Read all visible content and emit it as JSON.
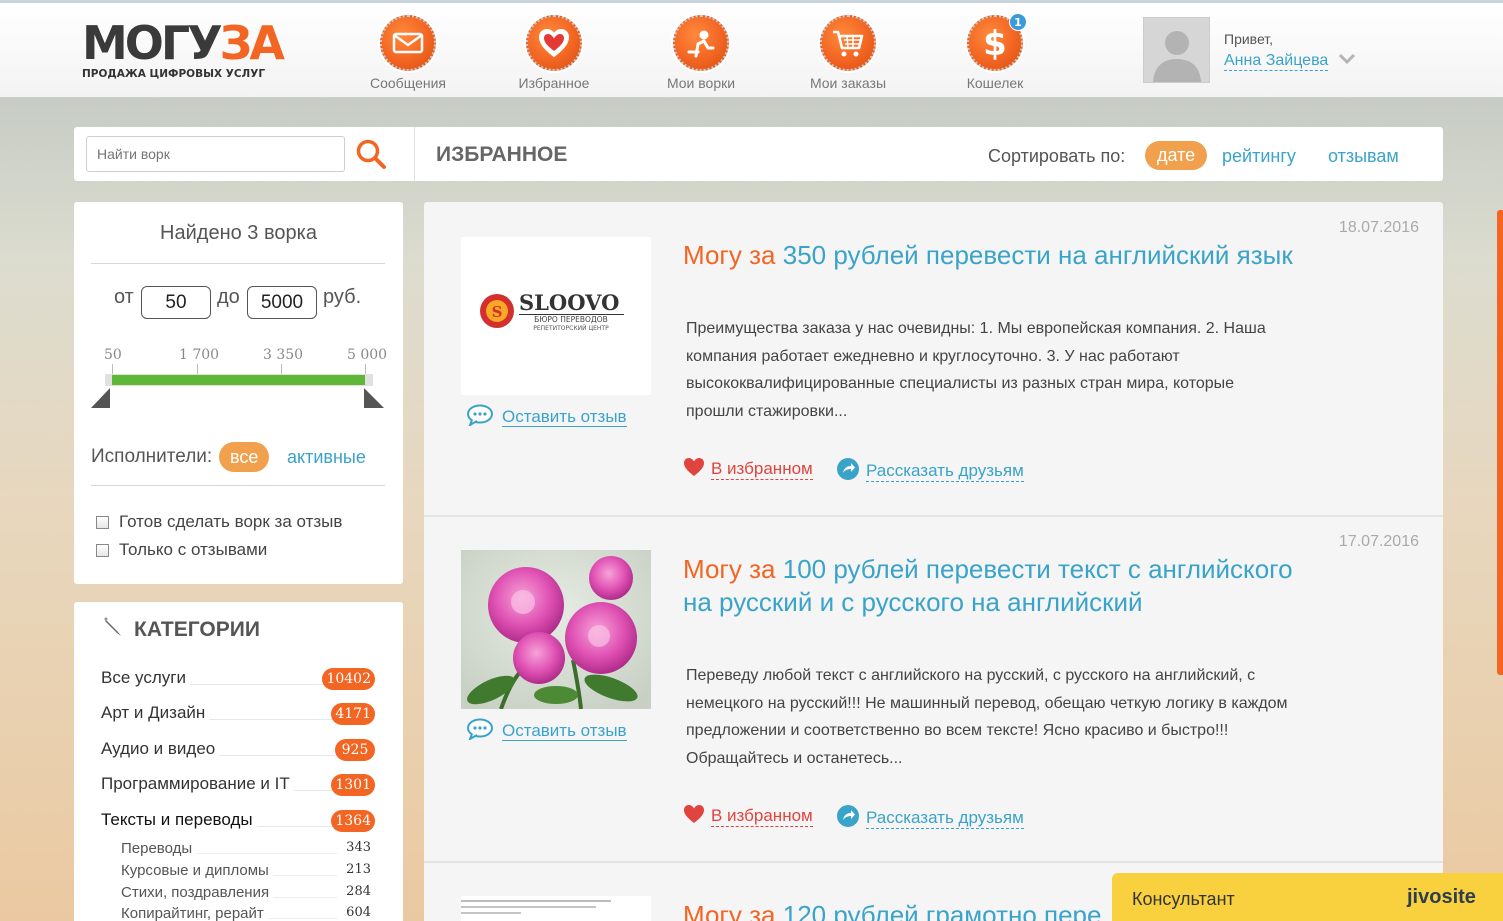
{
  "header": {
    "logo_main_a": "МОГУ",
    "logo_main_b": "ЗА",
    "logo_sub": "ПРОДАЖА ЦИФРОВЫХ УСЛУГ",
    "nav": [
      {
        "label": "Сообщения",
        "icon": "envelope-icon"
      },
      {
        "label": "Избранное",
        "icon": "heart-icon"
      },
      {
        "label": "Мои ворки",
        "icon": "person-icon"
      },
      {
        "label": "Мои заказы",
        "icon": "cart-icon"
      },
      {
        "label": "Кошелек",
        "icon": "dollar-icon",
        "badge": "1"
      }
    ],
    "greeting": "Привет,",
    "username": "Анна Зайцева"
  },
  "topbar": {
    "search_placeholder": "Найти ворк",
    "title": "ИЗБРАННОЕ",
    "sort_label": "Сортировать по:",
    "sort_options": [
      "дате",
      "рейтингу",
      "отзывам"
    ]
  },
  "filters": {
    "found": "Найдено 3 ворка",
    "price_from_label": "от",
    "price_from": "50",
    "price_to_label": "до",
    "price_to": "5000",
    "currency": "руб.",
    "scale": [
      "50",
      "1 700",
      "3 350",
      "5 000"
    ],
    "range": {
      "min": 50,
      "max": 5000,
      "from": 50,
      "to": 5000
    },
    "executors_label": "Исполнители:",
    "executors_options": [
      "все",
      "активные"
    ],
    "checkboxes": [
      "Готов сделать ворк за отзыв",
      "Только с отзывами"
    ]
  },
  "categories": {
    "title": "КАТЕГОРИИ",
    "items": [
      {
        "name": "Все услуги",
        "count": "10402"
      },
      {
        "name": "Арт и Дизайн",
        "count": "4171"
      },
      {
        "name": "Аудио и видео",
        "count": "925"
      },
      {
        "name": "Программирование и IT",
        "count": "1301"
      },
      {
        "name": "Тексты и переводы",
        "count": "1364"
      }
    ],
    "sub": [
      {
        "name": "Переводы",
        "count": "343"
      },
      {
        "name": "Курсовые и дипломы",
        "count": "213"
      },
      {
        "name": "Стихи, поздравления",
        "count": "284"
      },
      {
        "name": "Копирайтинг, рерайт",
        "count": "604"
      }
    ]
  },
  "items": [
    {
      "date": "18.07.2016",
      "title_prefix": "Могу за",
      "title": "350 рублей перевести на английский язык",
      "desc": "Преимущества заказа у нас очевидны: 1. Мы европейская компания. 2. Наша компания работает ежедневно и круглосуточно. 3. У нас работают высококвалифицированные специалисты из разных стран мира, которые прошли стажировки...",
      "image_brand": "SLOOVO",
      "image_sub1": "БЮРО ПЕРЕВОДОВ",
      "image_sub2": "РЕПЕТИТОРСКИЙ ЦЕНТР",
      "review": "Оставить отзыв",
      "fav": "В избранном",
      "share": "Рассказать друзьям"
    },
    {
      "date": "17.07.2016",
      "title_prefix": "Могу за",
      "title": "100 рублей перевести текст с английского на русский и с русского на английский",
      "desc": "Переведу любой текст с английского на русский, с русского на английский, с немецкого на русский!!! Не машинный перевод, обещаю четкую логику в каждом предложении и соответственно во всем тексте! Ясно красиво и быстро!!! Обращайтесь и останетесь...",
      "review": "Оставить отзыв",
      "fav": "В избранном",
      "share": "Рассказать друзьям"
    },
    {
      "title_prefix": "Могу за",
      "title": "120 рублей грамотно пере"
    }
  ],
  "chat": {
    "label": "Консультант",
    "brand": "jivosite"
  },
  "colors": {
    "accent": "#f26522",
    "link": "#3aa3c9",
    "pill": "#f1a04d",
    "slider": "#5cb836",
    "chat": "#f9d03e"
  }
}
